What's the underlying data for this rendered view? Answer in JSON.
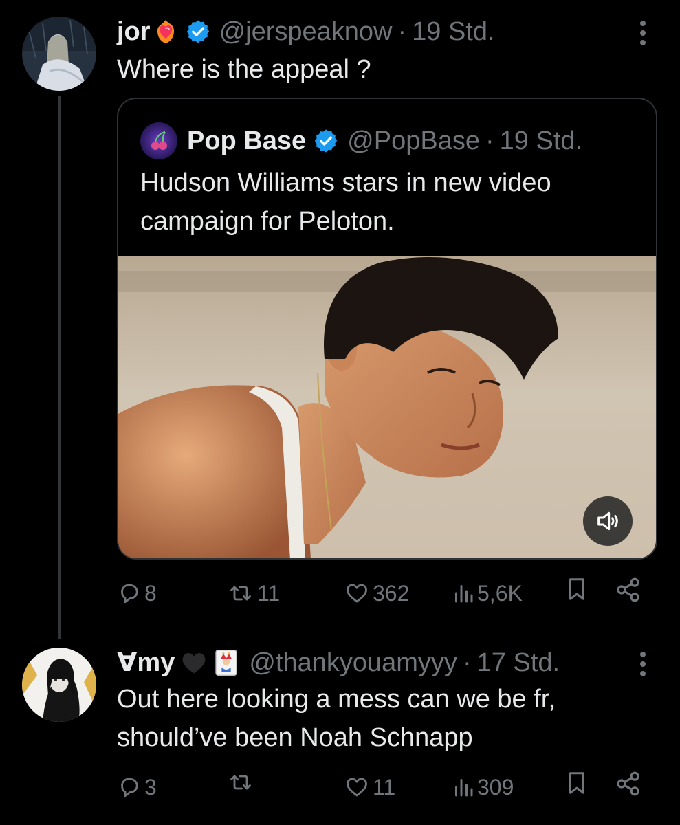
{
  "tweets": [
    {
      "author": {
        "name": "jor",
        "emoji_icon": "heart-on-fire-icon",
        "verified": true,
        "handle": "@jerspeaknow",
        "time": "19 Std."
      },
      "text": "Where is the appeal ?",
      "quote": {
        "author": {
          "name": "Pop Base",
          "verified": true,
          "handle": "@PopBase",
          "time": "19 Std."
        },
        "text": "Hudson Williams stars in new video campaign for Peloton.",
        "media": {
          "kind": "video-thumbnail",
          "mute_icon": "speaker-icon"
        }
      },
      "stats": {
        "replies": "8",
        "reposts": "11",
        "likes": "362",
        "views": "5,6K"
      }
    },
    {
      "author": {
        "name": "∀my",
        "emoji_icon": "black-heart-icon",
        "emoji_icon_2": "joker-card-icon",
        "verified": false,
        "handle": "@thankyouamyyy",
        "time": "17 Std."
      },
      "text_line1": "Out here looking a mess can we be fr,",
      "text_line2": "should’ve been Noah Schnapp",
      "stats": {
        "replies": "3",
        "reposts": "",
        "likes": "11",
        "views": "309"
      }
    }
  ],
  "colors": {
    "background": "#000000",
    "text_primary": "#e7e9ea",
    "text_secondary": "#71767b",
    "verified_blue": "#1d9bf0",
    "border": "#2f3336"
  },
  "separator": "·"
}
